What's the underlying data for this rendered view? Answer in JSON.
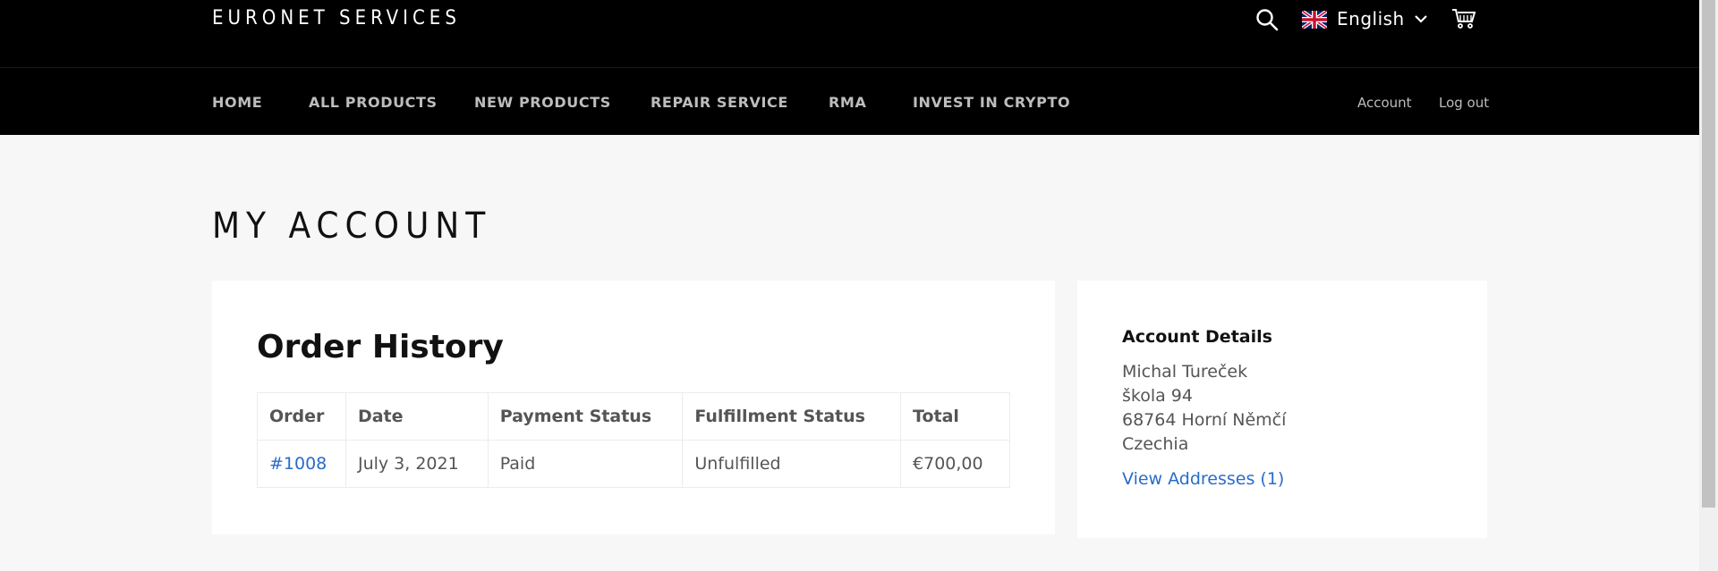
{
  "header": {
    "logo": "EURONET SERVICES",
    "language": "English",
    "icons": {
      "search": "search-icon",
      "flag": "uk-flag-icon",
      "chevron": "chevron-down-icon",
      "cart": "cart-icon"
    }
  },
  "nav": {
    "items": [
      {
        "label": "HOME"
      },
      {
        "label": "ALL PRODUCTS"
      },
      {
        "label": "NEW PRODUCTS"
      },
      {
        "label": "REPAIR SERVICE"
      },
      {
        "label": "RMA"
      },
      {
        "label": "INVEST IN CRYPTO"
      }
    ],
    "account": "Account",
    "logout": "Log out"
  },
  "page": {
    "title": "MY ACCOUNT"
  },
  "orders": {
    "title": "Order History",
    "columns": [
      "Order",
      "Date",
      "Payment Status",
      "Fulfillment Status",
      "Total"
    ],
    "rows": [
      {
        "order": "#1008",
        "date": "July 3, 2021",
        "payment": "Paid",
        "fulfillment": "Unfulfilled",
        "total": "€700,00"
      }
    ]
  },
  "account": {
    "title": "Account Details",
    "name": "Michal Tureček",
    "street": "škola 94",
    "city": "68764 Horní Němčí",
    "country": "Czechia",
    "addresses_link": "View Addresses (1)"
  },
  "colors": {
    "header_bg": "#000000",
    "page_bg": "#f7f7f7",
    "link": "#2a6cc9",
    "nav_text": "#bdbdbd"
  }
}
